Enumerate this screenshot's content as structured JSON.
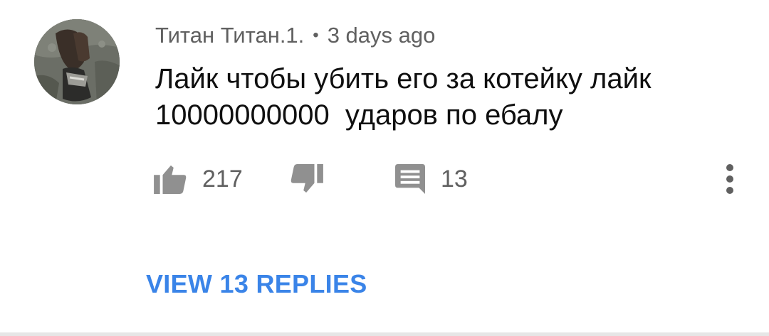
{
  "comment": {
    "author": "Титан Титан.1.",
    "separator": "•",
    "timestamp": "3 days ago",
    "text_lines": [
      "Лайк чтобы убить его за котейку лайк",
      "10000000000  ударов по ебалу"
    ],
    "avatar_icon": "avatar-photo",
    "like_icon": "thumbs-up-icon",
    "like_count": "217",
    "dislike_icon": "thumbs-down-icon",
    "reply_icon": "reply-comment-icon",
    "reply_count": "13",
    "more_icon": "more-vertical-icon",
    "view_replies_label": "VIEW 13 REPLIES"
  },
  "colors": {
    "meta_text": "#606060",
    "body_text": "#0f0f0f",
    "icon": "#909090",
    "link": "#3a84e8",
    "divider": "#e6e6e6"
  }
}
